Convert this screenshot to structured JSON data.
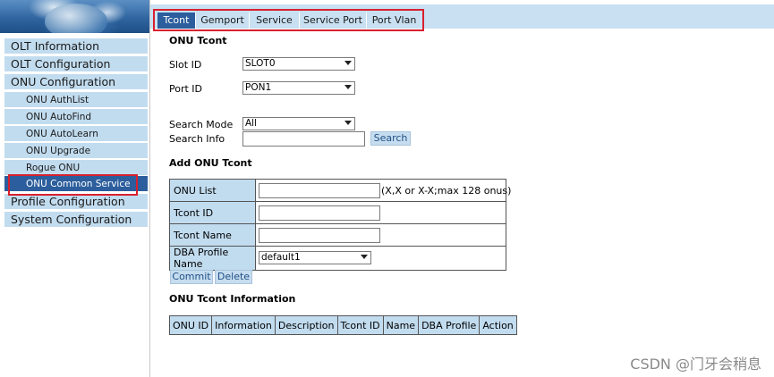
{
  "tabs": [
    "Tcont",
    "Gemport",
    "Service",
    "Service Port",
    "Port Vlan"
  ],
  "sidebar": {
    "items": [
      {
        "label": "OLT Information"
      },
      {
        "label": "OLT Configuration"
      },
      {
        "label": "ONU Configuration"
      },
      {
        "label": "ONU AuthList"
      },
      {
        "label": "ONU AutoFind"
      },
      {
        "label": "ONU AutoLearn"
      },
      {
        "label": "ONU Upgrade"
      },
      {
        "label": "Rogue ONU"
      },
      {
        "label": "ONU Common Service"
      },
      {
        "label": "Profile Configuration"
      },
      {
        "label": "System Configuration"
      }
    ]
  },
  "onu_tcont": {
    "title": "ONU Tcont",
    "slot_label": "Slot ID",
    "slot_value": "SLOT0",
    "port_label": "Port ID",
    "port_value": "PON1",
    "search_mode_label": "Search Mode",
    "search_mode_value": "All",
    "search_info_label": "Search Info",
    "search_info_value": "",
    "search_button": "Search"
  },
  "add_tcont": {
    "title": "Add ONU Tcont",
    "onu_list_label": "ONU List",
    "onu_list_value": "",
    "onu_list_hint": "(X,X or X-X;max 128 onus)",
    "tcont_id_label": "Tcont ID",
    "tcont_id_value": "",
    "tcont_name_label": "Tcont Name",
    "tcont_name_value": "",
    "dba_label": "DBA Profile Name",
    "dba_value": "default1",
    "commit_button": "Commit",
    "delete_button": "Delete"
  },
  "info": {
    "title": "ONU Tcont Information",
    "columns": [
      "ONU ID",
      "Information",
      "Description",
      "Tcont ID",
      "Name",
      "DBA Profile",
      "Action"
    ]
  },
  "watermark": "CSDN @门牙会稍息",
  "colors": {
    "active": "#2c5e9d",
    "nav_bg": "#c2dcef",
    "highlight": "#d9202e"
  }
}
